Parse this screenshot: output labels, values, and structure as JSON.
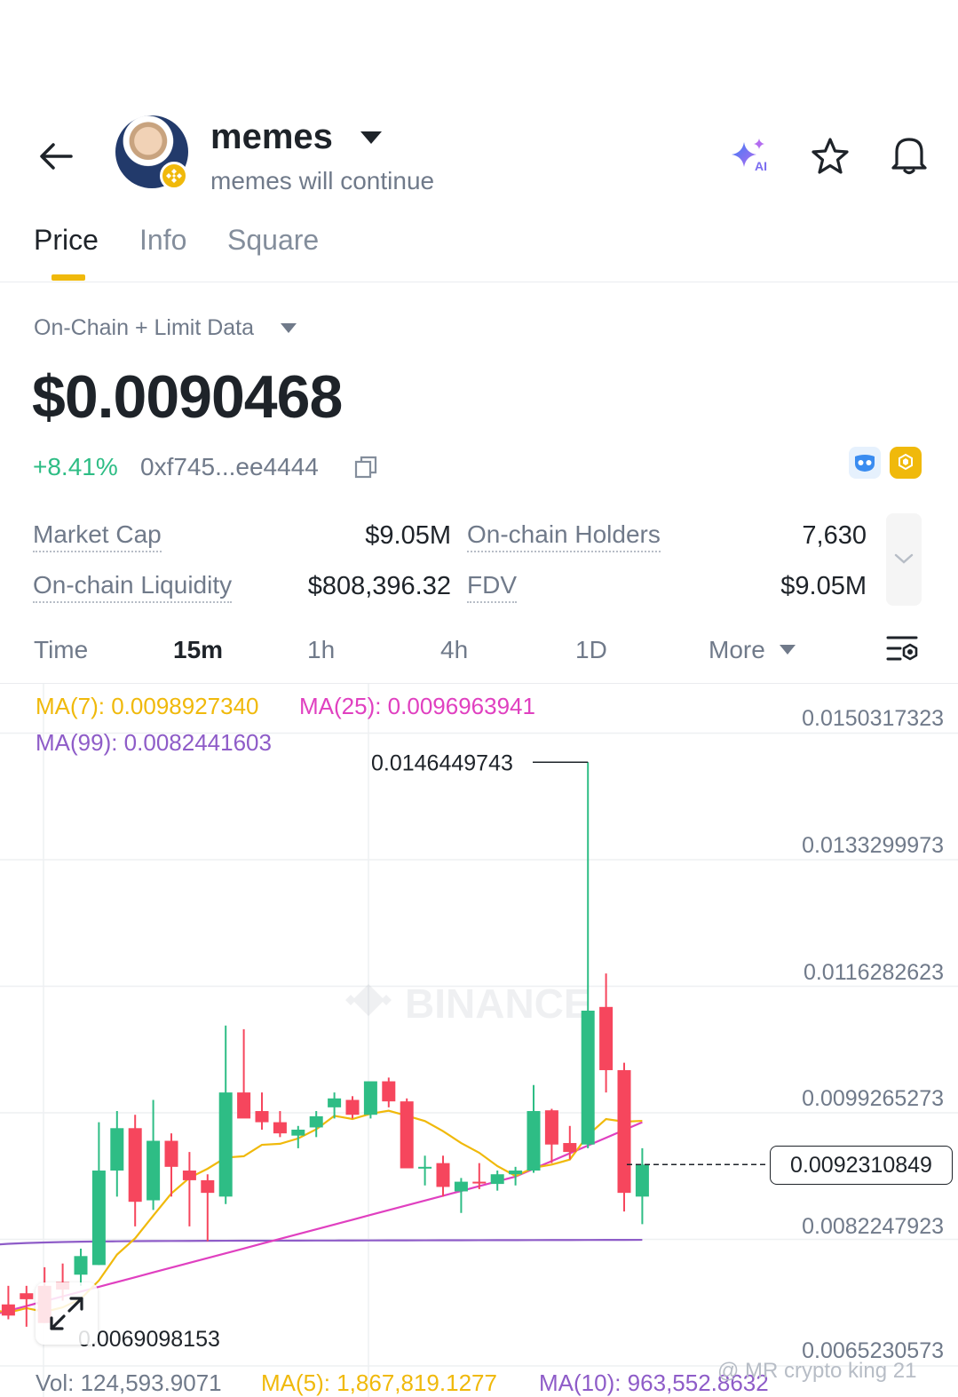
{
  "header": {
    "title": "memes",
    "subtitle": "memes will continue"
  },
  "tabs": [
    {
      "label": "Price",
      "active": true
    },
    {
      "label": "Info",
      "active": false
    },
    {
      "label": "Square",
      "active": false
    }
  ],
  "price_panel": {
    "source_label": "On-Chain + Limit Data",
    "price": "$0.0090468",
    "change": "+8.41%",
    "contract": "0xf745...ee4444"
  },
  "stats": {
    "market_cap_label": "Market Cap",
    "market_cap_value": "$9.05M",
    "holders_label": "On-chain Holders",
    "holders_value": "7,630",
    "liquidity_label": "On-chain Liquidity",
    "liquidity_value": "$808,396.32",
    "fdv_label": "FDV",
    "fdv_value": "$9.05M"
  },
  "intervals": {
    "time_label": "Time",
    "items": [
      "15m",
      "1h",
      "4h",
      "1D"
    ],
    "active": "15m",
    "more_label": "More"
  },
  "chart_data": {
    "type": "candlestick",
    "watermark": "BINANCE",
    "ma_legend": {
      "ma7": "MA(7): 0.0098927340",
      "ma25": "MA(25): 0.0096963941",
      "ma99": "MA(99): 0.0082441603"
    },
    "y_axis_ticks": [
      "0.0150317323",
      "0.0133299973",
      "0.0116282623",
      "0.0099265273",
      "0.0082247923",
      "0.0065230573"
    ],
    "high_label": "0.0146449743",
    "low_label": "0.0069098153",
    "current_price_label": "0.0092310849",
    "current_price": 0.0092310849,
    "candles": [
      {
        "o": 0.00755,
        "h": 0.00775,
        "l": 0.00725,
        "c": 0.00728
      },
      {
        "o": 0.00735,
        "h": 0.0076,
        "l": 0.00715,
        "c": 0.0072
      },
      {
        "o": 0.0075,
        "h": 0.0076,
        "l": 0.00705,
        "c": 0.00742
      },
      {
        "o": 0.0076,
        "h": 0.00785,
        "l": 0.0071,
        "c": 0.0071
      },
      {
        "o": 0.00765,
        "h": 0.0079,
        "l": 0.0074,
        "c": 0.00755
      },
      {
        "o": 0.00775,
        "h": 0.0081,
        "l": 0.0076,
        "c": 0.008
      },
      {
        "o": 0.00788,
        "h": 0.0098,
        "l": 0.00788,
        "c": 0.00915
      },
      {
        "o": 0.00915,
        "h": 0.00995,
        "l": 0.0088,
        "c": 0.00972
      },
      {
        "o": 0.00972,
        "h": 0.0099,
        "l": 0.0084,
        "c": 0.00873
      },
      {
        "o": 0.00875,
        "h": 0.0101,
        "l": 0.00862,
        "c": 0.00955
      },
      {
        "o": 0.00955,
        "h": 0.00965,
        "l": 0.0088,
        "c": 0.0092
      },
      {
        "o": 0.00915,
        "h": 0.0094,
        "l": 0.0084,
        "c": 0.00902
      },
      {
        "o": 0.00902,
        "h": 0.0091,
        "l": 0.0082,
        "c": 0.00885
      },
      {
        "o": 0.0088,
        "h": 0.0111,
        "l": 0.0087,
        "c": 0.0102
      },
      {
        "o": 0.0102,
        "h": 0.01105,
        "l": 0.0099,
        "c": 0.00985
      },
      {
        "o": 0.00995,
        "h": 0.0102,
        "l": 0.0097,
        "c": 0.0098
      },
      {
        "o": 0.0098,
        "h": 0.00995,
        "l": 0.0096,
        "c": 0.00965
      },
      {
        "o": 0.00962,
        "h": 0.00975,
        "l": 0.00945,
        "c": 0.0097
      },
      {
        "o": 0.00973,
        "h": 0.00995,
        "l": 0.0096,
        "c": 0.00988
      },
      {
        "o": 0.01,
        "h": 0.0102,
        "l": 0.00985,
        "c": 0.01012
      },
      {
        "o": 0.0101,
        "h": 0.01015,
        "l": 0.00985,
        "c": 0.0099
      },
      {
        "o": 0.0099,
        "h": 0.0103,
        "l": 0.00985,
        "c": 0.01035
      },
      {
        "o": 0.01035,
        "h": 0.0104,
        "l": 0.01,
        "c": 0.01008
      },
      {
        "o": 0.01008,
        "h": 0.01012,
        "l": 0.0095,
        "c": 0.00918
      },
      {
        "o": 0.0092,
        "h": 0.00935,
        "l": 0.00895,
        "c": 0.0092
      },
      {
        "o": 0.00925,
        "h": 0.00935,
        "l": 0.0088,
        "c": 0.00893
      },
      {
        "o": 0.00887,
        "h": 0.00905,
        "l": 0.00858,
        "c": 0.009
      },
      {
        "o": 0.009,
        "h": 0.00925,
        "l": 0.0089,
        "c": 0.00898
      },
      {
        "o": 0.00897,
        "h": 0.00915,
        "l": 0.00888,
        "c": 0.0091
      },
      {
        "o": 0.0091,
        "h": 0.0092,
        "l": 0.00895,
        "c": 0.00915
      },
      {
        "o": 0.00915,
        "h": 0.0103,
        "l": 0.00912,
        "c": 0.00995
      },
      {
        "o": 0.00996,
        "h": 0.00998,
        "l": 0.00925,
        "c": 0.0095
      },
      {
        "o": 0.00952,
        "h": 0.00975,
        "l": 0.0093,
        "c": 0.0094
      },
      {
        "o": 0.0095,
        "h": 0.01464,
        "l": 0.00945,
        "c": 0.0113
      },
      {
        "o": 0.01135,
        "h": 0.0118,
        "l": 0.0102,
        "c": 0.0105
      },
      {
        "o": 0.0105,
        "h": 0.0106,
        "l": 0.0086,
        "c": 0.00885
      },
      {
        "o": 0.0088,
        "h": 0.00945,
        "l": 0.00843,
        "c": 0.00923
      }
    ]
  },
  "volume_row": {
    "vol": "Vol: 124,593.9071",
    "ma5": "MA(5): 1,867,819.1277",
    "ma10": "MA(10): 963,552.8632"
  },
  "watermark_text": "@ MR crypto king 21",
  "colors": {
    "up": "#2ebd85",
    "down": "#f6465d",
    "ma7": "#f0b90b",
    "ma25": "#e040c0",
    "ma99": "#8e5cc8",
    "accent": "#f0b90b"
  }
}
